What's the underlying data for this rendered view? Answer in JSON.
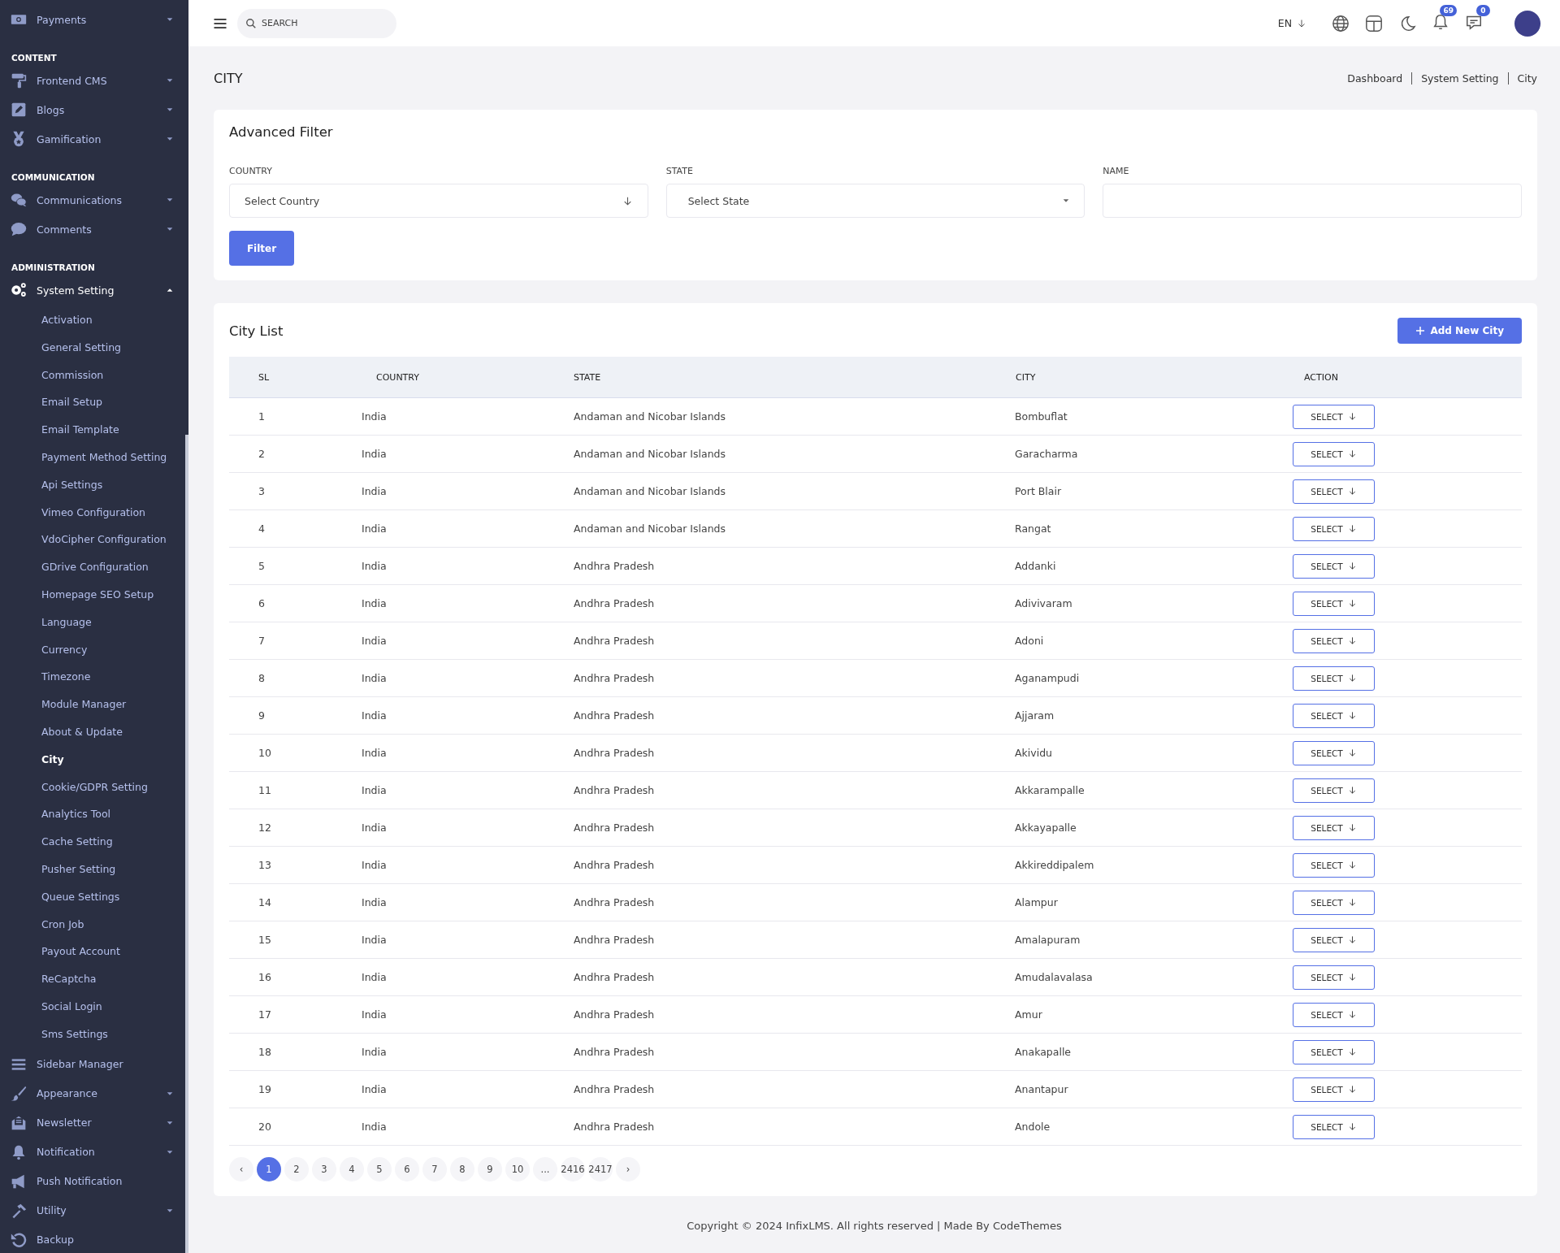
{
  "sidebar": {
    "sections": [
      {
        "items": [
          {
            "label": "Payments",
            "kind": "menu",
            "expanded": false
          }
        ]
      },
      {
        "heading": "CONTENT",
        "items": [
          {
            "label": "Frontend CMS",
            "kind": "menu",
            "expanded": false
          },
          {
            "label": "Blogs",
            "kind": "menu",
            "expanded": false
          },
          {
            "label": "Gamification",
            "kind": "menu",
            "expanded": false
          }
        ]
      },
      {
        "heading": "COMMUNICATION",
        "items": [
          {
            "label": "Communications",
            "kind": "menu",
            "expanded": false
          },
          {
            "label": "Comments",
            "kind": "menu",
            "expanded": false
          }
        ]
      },
      {
        "heading": "ADMINISTRATION",
        "items": [
          {
            "label": "System Setting",
            "kind": "menu",
            "expanded": true,
            "children": [
              {
                "label": "Activation",
                "selected": false
              },
              {
                "label": "General Setting",
                "selected": false
              },
              {
                "label": "Commission",
                "selected": false
              },
              {
                "label": "Email Setup",
                "selected": false
              },
              {
                "label": "Email Template",
                "selected": false
              },
              {
                "label": "Payment Method Setting",
                "selected": false
              },
              {
                "label": "Api Settings",
                "selected": false
              },
              {
                "label": "Vimeo Configuration",
                "selected": false
              },
              {
                "label": "VdoCipher Configuration",
                "selected": false
              },
              {
                "label": "GDrive Configuration",
                "selected": false
              },
              {
                "label": "Homepage SEO Setup",
                "selected": false
              },
              {
                "label": "Language",
                "selected": false
              },
              {
                "label": "Currency",
                "selected": false
              },
              {
                "label": "Timezone",
                "selected": false
              },
              {
                "label": "Module Manager",
                "selected": false
              },
              {
                "label": "About & Update",
                "selected": false
              },
              {
                "label": "City",
                "selected": true
              },
              {
                "label": "Cookie/GDPR Setting",
                "selected": false
              },
              {
                "label": "Analytics Tool",
                "selected": false
              },
              {
                "label": "Cache Setting",
                "selected": false
              },
              {
                "label": "Pusher Setting",
                "selected": false
              },
              {
                "label": "Queue Settings",
                "selected": false
              },
              {
                "label": "Cron Job",
                "selected": false
              },
              {
                "label": "Payout Account",
                "selected": false
              },
              {
                "label": "ReCaptcha",
                "selected": false
              },
              {
                "label": "Social Login",
                "selected": false
              },
              {
                "label": "Sms Settings",
                "selected": false
              }
            ]
          },
          {
            "label": "Sidebar Manager",
            "kind": "link"
          },
          {
            "label": "Appearance",
            "kind": "menu",
            "expanded": false
          },
          {
            "label": "Newsletter",
            "kind": "menu",
            "expanded": false
          },
          {
            "label": "Notification",
            "kind": "menu",
            "expanded": false
          },
          {
            "label": "Push Notification",
            "kind": "link"
          },
          {
            "label": "Utility",
            "kind": "menu",
            "expanded": false
          },
          {
            "label": "Backup",
            "kind": "link"
          }
        ]
      }
    ]
  },
  "topbar": {
    "search": {
      "placeholder": "SEARCH"
    },
    "language": "EN",
    "notifications": "69",
    "messages": "0"
  },
  "page": {
    "title": "CITY",
    "breadcrumb": [
      "Dashboard",
      "System Setting",
      "City"
    ]
  },
  "filter": {
    "title": "Advanced Filter",
    "fields": [
      {
        "label": "COUNTRY",
        "kind": "select",
        "value": "Select Country"
      },
      {
        "label": "STATE",
        "kind": "caret-select",
        "value": "Select State"
      },
      {
        "label": "NAME",
        "kind": "text"
      }
    ],
    "button": "Filter"
  },
  "city_list": {
    "title": "City List",
    "add_button": "Add New City",
    "columns": [
      "SL",
      "COUNTRY",
      "STATE",
      "CITY",
      "ACTION"
    ],
    "rows": [
      [
        "1",
        "India",
        "Andaman and Nicobar Islands",
        "Bombuflat",
        "SELECT"
      ],
      [
        "2",
        "India",
        "Andaman and Nicobar Islands",
        "Garacharma",
        "SELECT"
      ],
      [
        "3",
        "India",
        "Andaman and Nicobar Islands",
        "Port Blair",
        "SELECT"
      ],
      [
        "4",
        "India",
        "Andaman and Nicobar Islands",
        "Rangat",
        "SELECT"
      ],
      [
        "5",
        "India",
        "Andhra Pradesh",
        "Addanki",
        "SELECT"
      ],
      [
        "6",
        "India",
        "Andhra Pradesh",
        "Adivivaram",
        "SELECT"
      ],
      [
        "7",
        "India",
        "Andhra Pradesh",
        "Adoni",
        "SELECT"
      ],
      [
        "8",
        "India",
        "Andhra Pradesh",
        "Aganampudi",
        "SELECT"
      ],
      [
        "9",
        "India",
        "Andhra Pradesh",
        "Ajjaram",
        "SELECT"
      ],
      [
        "10",
        "India",
        "Andhra Pradesh",
        "Akividu",
        "SELECT"
      ],
      [
        "11",
        "India",
        "Andhra Pradesh",
        "Akkarampalle",
        "SELECT"
      ],
      [
        "12",
        "India",
        "Andhra Pradesh",
        "Akkayapalle",
        "SELECT"
      ],
      [
        "13",
        "India",
        "Andhra Pradesh",
        "Akkireddipalem",
        "SELECT"
      ],
      [
        "14",
        "India",
        "Andhra Pradesh",
        "Alampur",
        "SELECT"
      ],
      [
        "15",
        "India",
        "Andhra Pradesh",
        "Amalapuram",
        "SELECT"
      ],
      [
        "16",
        "India",
        "Andhra Pradesh",
        "Amudalavalasa",
        "SELECT"
      ],
      [
        "17",
        "India",
        "Andhra Pradesh",
        "Amur",
        "SELECT"
      ],
      [
        "18",
        "India",
        "Andhra Pradesh",
        "Anakapalle",
        "SELECT"
      ],
      [
        "19",
        "India",
        "Andhra Pradesh",
        "Anantapur",
        "SELECT"
      ],
      [
        "20",
        "India",
        "Andhra Pradesh",
        "Andole",
        "SELECT"
      ]
    ],
    "pagination": {
      "prev": "‹",
      "next": "›",
      "pages": [
        {
          "label": "1",
          "selected": true
        },
        {
          "label": "2",
          "selected": false
        },
        {
          "label": "3",
          "selected": false
        },
        {
          "label": "4",
          "selected": false
        },
        {
          "label": "5",
          "selected": false
        },
        {
          "label": "6",
          "selected": false
        },
        {
          "label": "7",
          "selected": false
        },
        {
          "label": "8",
          "selected": false
        },
        {
          "label": "9",
          "selected": false
        },
        {
          "label": "10",
          "selected": false
        },
        {
          "label": "...",
          "selected": false
        },
        {
          "label": "2416",
          "selected": false
        },
        {
          "label": "2417",
          "selected": false
        }
      ]
    }
  },
  "footer": "Copyright © 2024 InfixLMS. All rights reserved | Made By CodeThemes"
}
